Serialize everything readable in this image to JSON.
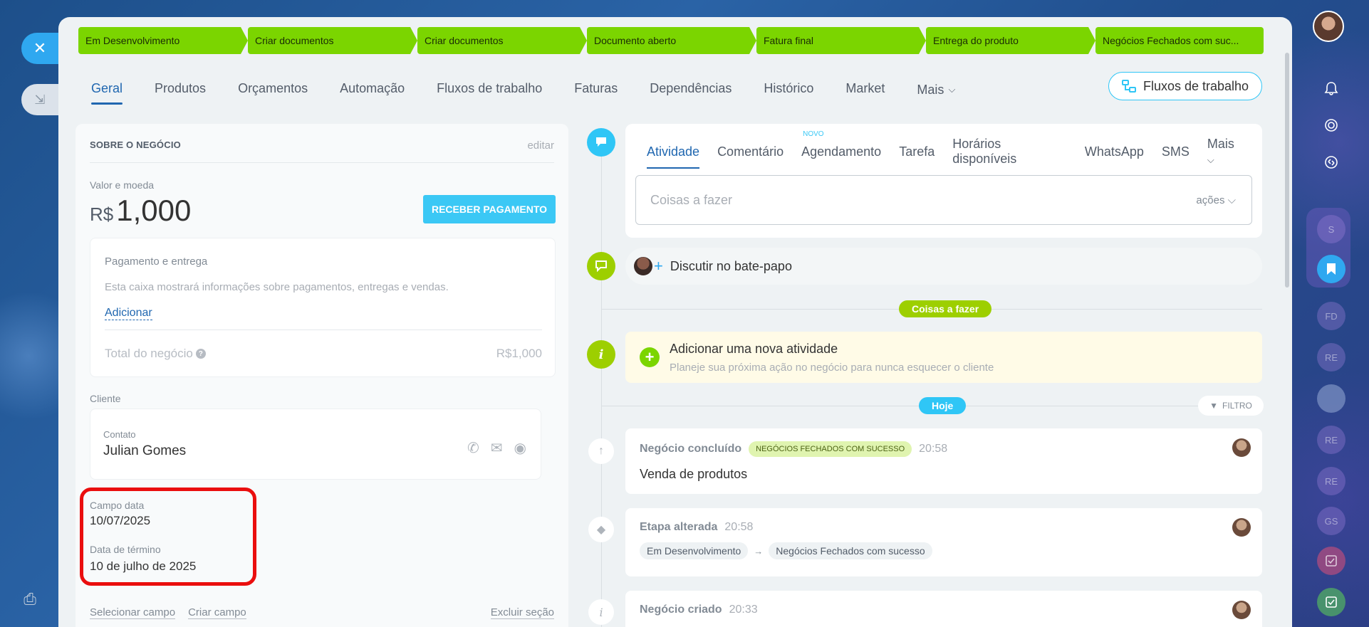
{
  "stages": [
    "Em Desenvolvimento",
    "Criar documentos",
    "Criar documentos",
    "Documento aberto",
    "Fatura final",
    "Entrega do produto",
    "Negócios Fechados com suc..."
  ],
  "tabs": [
    "Geral",
    "Produtos",
    "Orçamentos",
    "Automação",
    "Fluxos de trabalho",
    "Faturas",
    "Dependências",
    "Histórico",
    "Market",
    "Mais"
  ],
  "workflow_button": "Fluxos de trabalho",
  "about": {
    "title": "SOBRE O NEGÓCIO",
    "edit": "editar",
    "value_label": "Valor e moeda",
    "currency": "R$",
    "amount": "1,000",
    "pay_button": "RECEBER PAGAMENTO",
    "payment_title": "Pagamento e entrega",
    "payment_desc": "Esta caixa mostrará informações sobre pagamentos, entregas e vendas.",
    "payment_add": "Adicionar",
    "total_label": "Total do negócio",
    "total_value": "R$1,000",
    "client_label": "Cliente",
    "contact_label": "Contato",
    "contact_name": "Julian Gomes",
    "date_field_label": "Campo data",
    "date_field_value": "10/07/2025",
    "end_date_label": "Data de término",
    "end_date_value": "10 de julho de 2025",
    "select_field": "Selecionar campo",
    "create_field": "Criar campo",
    "delete_section": "Excluir seção"
  },
  "activity": {
    "tabs": [
      "Atividade",
      "Comentário",
      "Agendamento",
      "Tarefa",
      "Horários disponíveis",
      "WhatsApp",
      "SMS",
      "Mais"
    ],
    "new_badge": "NOVO",
    "todo_placeholder": "Coisas a fazer",
    "actions": "ações",
    "chat": "Discutir no bate-papo",
    "todo_label": "Coisas a fazer",
    "add_title": "Adicionar uma nova atividade",
    "add_desc": "Planeje sua próxima ação no negócio para nunca esquecer o cliente",
    "today": "Hoje",
    "filter": "FILTRO"
  },
  "events": [
    {
      "title": "Negócio concluído",
      "badge": "NEGÓCIOS FECHADOS COM SUCESSO",
      "time": "20:58",
      "body": "Venda de produtos"
    },
    {
      "title": "Etapa alterada",
      "time": "20:58",
      "from": "Em Desenvolvimento",
      "to": "Negócios Fechados com sucesso"
    },
    {
      "title": "Negócio criado",
      "time": "20:33"
    }
  ],
  "right_sidebar": [
    "S",
    "FD",
    "RE",
    "RE",
    "RE",
    "GS"
  ],
  "colors": {
    "stage": "#7bd500",
    "accent": "#2fc6f6",
    "link": "#2067b0",
    "highlight": "#ea0e0e"
  }
}
